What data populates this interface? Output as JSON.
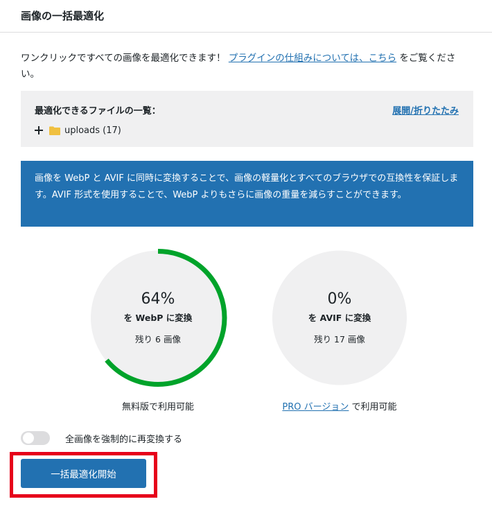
{
  "header": {
    "title": "画像の一括最適化"
  },
  "intro": {
    "text_before": "ワンクリックですべての画像を最適化できます！",
    "link_text": "プラグインの仕組みについては、こちら",
    "text_after": "をご覧ください。"
  },
  "files": {
    "title": "最適化できるファイルの一覧：",
    "toggle_label": "展開/折りたたみ",
    "folders": [
      {
        "name": "uploads (17)"
      }
    ]
  },
  "notice": {
    "text": "画像を WebP と AVIF に同時に変換することで、画像の軽量化とすべてのブラウザでの互換性を保証します。AVIF 形式を使用することで、WebP よりもさらに画像の重量を減らすことができます。"
  },
  "webp": {
    "percent": "64%",
    "progress": 0.64,
    "label": "を WebP に変換",
    "remaining": "残り 6 画像",
    "caption": "無料版で利用可能"
  },
  "avif": {
    "percent": "0%",
    "progress": 0,
    "label": "を AVIF に変換",
    "remaining": "残り 17 画像",
    "caption_link": "PRO バージョン",
    "caption_after": "で利用可能"
  },
  "force": {
    "label": "全画像を強制的に再変換する"
  },
  "start_button": {
    "label": "一括最適化開始"
  },
  "colors": {
    "accent": "#2271b1",
    "progress": "#00a32a",
    "highlight": "#e6001a",
    "track": "#f0f0f1"
  }
}
